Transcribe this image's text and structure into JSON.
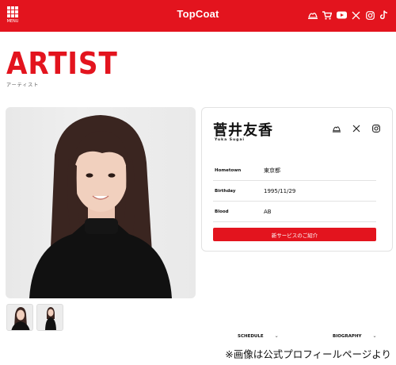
{
  "header": {
    "menu_label": "MENU",
    "brand": "TopCoat",
    "icons": [
      "fc-logo-icon",
      "cart-icon",
      "youtube-icon",
      "x-icon",
      "instagram-icon",
      "tiktok-icon"
    ],
    "background": "#e3141e"
  },
  "page": {
    "title": "ARTIST",
    "subtitle": "アーティスト",
    "accent": "#e3141e"
  },
  "artist": {
    "name": "菅井友香",
    "romaji": "Yuka Sugai",
    "social_icons": [
      "fc-logo-icon",
      "x-icon",
      "instagram-icon"
    ],
    "details": [
      {
        "label": "Hometown",
        "value": "東京都"
      },
      {
        "label": "Birthday",
        "value": "1995/11/29"
      },
      {
        "label": "Blood",
        "value": "AB"
      }
    ],
    "cta_label": "新サービスのご紹介"
  },
  "tabs": [
    {
      "label": "SCHEDULE",
      "chevron": "⌄"
    },
    {
      "label": "BIOGRAPHY",
      "chevron": "⌄"
    }
  ],
  "caption": "※画像は公式プロフィールページより"
}
